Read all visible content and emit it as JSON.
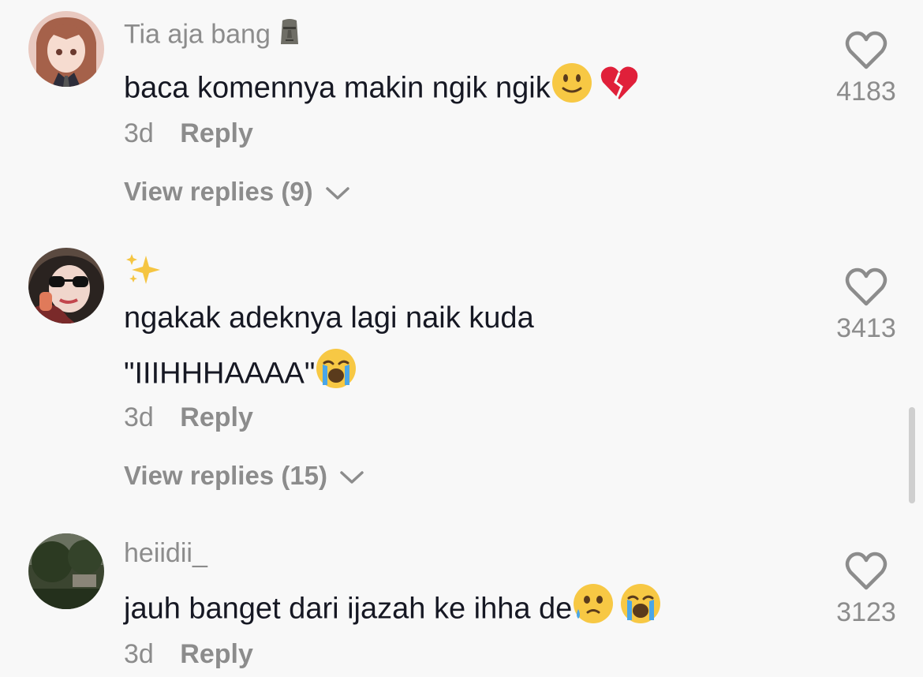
{
  "comments": [
    {
      "username": "Tia aja bang",
      "username_emoji": "moai",
      "text_lines": [
        "baca komennya makin ngik ngik"
      ],
      "text_emojis": [
        "slightly-smiling-face",
        "broken-heart"
      ],
      "time": "3d",
      "reply_label": "Reply",
      "view_replies": "View replies (9)",
      "likes": "4183"
    },
    {
      "username": "",
      "username_emoji": "sparkles",
      "text_lines": [
        "ngakak adeknya lagi naik kuda",
        "\"IIIHHHAAAA\""
      ],
      "text_emojis": [
        "loudly-crying-face"
      ],
      "time": "3d",
      "reply_label": "Reply",
      "view_replies": "View replies (15)",
      "likes": "3413"
    },
    {
      "username": "heiidii_",
      "username_emoji": "",
      "text_lines": [
        "jauh banget dari ijazah ke ihha de"
      ],
      "text_emojis": [
        "face-holding-back-tears",
        "loudly-crying-face"
      ],
      "time": "3d",
      "reply_label": "Reply",
      "view_replies": "",
      "likes": "3123"
    }
  ],
  "colors": {
    "background": "#f8f8f8",
    "text_primary": "#161823",
    "text_secondary": "#8c8c8c"
  }
}
